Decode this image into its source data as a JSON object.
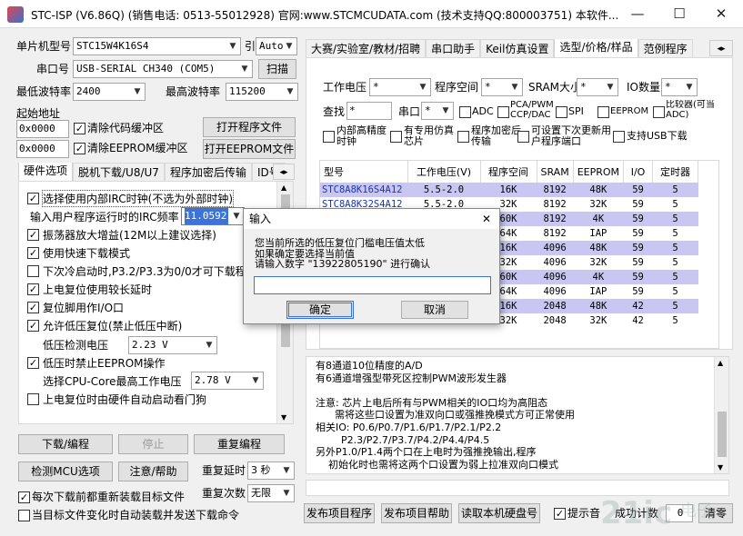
{
  "window": {
    "title": "STC-ISP (V6.86Q) (销售电话: 0513-55012928) 官网:www.STCMCUDATA.com  (技术支持QQ:800003751) 本软件...",
    "minimize": "—",
    "maximize": "☐",
    "close": "✕"
  },
  "left": {
    "mcu_label": "单片机型号",
    "mcu_value": "STC15W4K16S4",
    "pins_label": "引脚数",
    "pins_value": "Auto",
    "port_label": "串口号",
    "port_value": "USB-SERIAL CH340 (COM5)",
    "scan_button": "扫描",
    "min_baud_label": "最低波特率",
    "min_baud_value": "2400",
    "max_baud_label": "最高波特率",
    "max_baud_value": "115200",
    "start_addr_label": "起始地址",
    "addr1": "0x0000",
    "clear_code_label": "清除代码缓冲区",
    "open_prog_button": "打开程序文件",
    "addr2": "0x0000",
    "clear_eeprom_label": "清除EEPROM缓冲区",
    "open_eeprom_button": "打开EEPROM文件",
    "tabs": [
      "硬件选项",
      "脱机下载/U8/U7",
      "程序加密后传输",
      "ID号"
    ],
    "tab_more": "◂▸",
    "options": [
      {
        "label": "选择使用内部IRC时钟(不选为外部时钟)",
        "checked": true
      },
      {
        "label": "输入用户程序运行时的IRC频率",
        "checked": null
      },
      {
        "label": "振荡器放大增益(12M以上建议选择)",
        "checked": true
      },
      {
        "label": "使用快速下载模式",
        "checked": true
      },
      {
        "label": "下次冷启动时,P3.2/P3.3为0/0才可下载程序",
        "checked": false
      },
      {
        "label": "上电复位使用较长延时",
        "checked": true
      },
      {
        "label": "复位脚用作I/O口",
        "checked": true
      },
      {
        "label": "允许低压复位(禁止低压中断)",
        "checked": true
      },
      {
        "label": "低压检测电压",
        "checked": null
      },
      {
        "label": "低压时禁止EEPROM操作",
        "checked": true
      },
      {
        "label": "选择CPU-Core最高工作电压",
        "checked": null
      },
      {
        "label": "上电复位时由硬件自动启动看门狗",
        "checked": false
      }
    ],
    "irc_freq": "11.0592",
    "low_voltage": "2.23 V",
    "core_voltage": "2.78 V",
    "download_button": "下载/编程",
    "stop_button": "停止",
    "reprogram_button": "重复编程",
    "detect_button": "检测MCU选项",
    "help_button": "注意/帮助",
    "repeat_delay_label": "重复延时",
    "repeat_delay_value": "3 秒",
    "repeat_count_label": "重复次数",
    "repeat_count_value": "无限",
    "reload_label": "每次下载前都重新装载目标文件",
    "auto_load_label": "当目标文件变化时自动装载并发送下载命令"
  },
  "right": {
    "tabs": [
      "大赛/实验室/教材/招聘",
      "串口助手",
      "Keil仿真设置",
      "选型/价格/样品",
      "范例程序"
    ],
    "filter": {
      "voltage_label": "工作电压",
      "voltage_value": "*",
      "prog_space_label": "程序空间",
      "prog_space_value": "*",
      "sram_label": "SRAM大小",
      "sram_value": "*",
      "io_label": "IO数量",
      "io_value": "*",
      "search_label": "查找",
      "search_value": "*",
      "uart_label": "串口",
      "uart_value": "*",
      "adc": "ADC",
      "pca": "PCA/PWM CCP/DAC",
      "spi": "SPI",
      "eeprom": "EEPROM",
      "comparator": "比较器(可当ADC)",
      "internal_reset": "内部高精度时钟",
      "dedicated_sim": "有专用仿真芯片",
      "encrypted": "程序加密后传输",
      "user_update": "可设置下次更新用户程序端口",
      "usb": "支持USB下载"
    },
    "table_headers": [
      "型号",
      "工作电压(V)",
      "程序空间",
      "SRAM",
      "EEPROM",
      "I/O",
      "定时器"
    ],
    "rows": [
      [
        "STC8A8K16S4A12",
        "5.5-2.0",
        "16K",
        "8192",
        "48K",
        "59",
        "5"
      ],
      [
        "STC8A8K32S4A12",
        "5.5-2.0",
        "32K",
        "8192",
        "32K",
        "59",
        "5"
      ],
      [
        "STC8A8K60S4A12",
        "5.5-2.0",
        "60K",
        "8192",
        "4K",
        "59",
        "5"
      ],
      [
        "STC8A8K64S4A12",
        "5.5-2.0",
        "64K",
        "8192",
        "IAP",
        "59",
        "5"
      ],
      [
        "STC8A4K16S2A12",
        "5.5-2.0",
        "16K",
        "4096",
        "48K",
        "59",
        "5"
      ],
      [
        "STC8A4K32S2A12",
        "5.5-2.0",
        "32K",
        "4096",
        "32K",
        "59",
        "5"
      ],
      [
        "STC8A4K60S2A12",
        "5.5-2.0",
        "60K",
        "4096",
        "4K",
        "59",
        "5"
      ],
      [
        "STC8A4K64S2A12",
        "5.5-2.0",
        "64K",
        "4096",
        "IAP",
        "59",
        "5"
      ],
      [
        "STC8F2K16S4",
        "5.5-2.0",
        "16K",
        "2048",
        "48K",
        "42",
        "5"
      ],
      [
        "STC8F2K32S4",
        "5.5-2.0",
        "32K",
        "2048",
        "32K",
        "42",
        "5"
      ]
    ],
    "info_lines": [
      "有8通道10位精度的A/D",
      "有6通道增强型带死区控制PWM波形发生器",
      "",
      "注意: 芯片上电后所有与PWM相关的IO口均为高阻态",
      "      需将这些口设置为准双向口或强推挽模式方可正常使用",
      "相关IO: P0.6/P0.7/P1.6/P1.7/P2.1/P2.2",
      "        P2.3/P2.7/P3.7/P4.2/P4.4/P4.5",
      "另外P1.0/P1.4两个口在上电时为强推挽输出,程序",
      "    初始化时也需将这两个口设置为弱上拉准双向口模式"
    ],
    "publish_button": "发布项目程序",
    "publish_help_button": "发布项目帮助",
    "read_disk_button": "读取本机硬盘号",
    "beep_label": "提示音",
    "success_label": "成功计数",
    "success_value": "0",
    "clear_button": "清零"
  },
  "dialog": {
    "title": "输入",
    "close": "✕",
    "message_lines": [
      "您当前所选的低压复位门槛电压值太低",
      "如果确定要选择当前值",
      "请输入数字 \"13922805190\" 进行确认"
    ],
    "input_value": "",
    "ok_button": "确定",
    "cancel_button": "取消"
  }
}
